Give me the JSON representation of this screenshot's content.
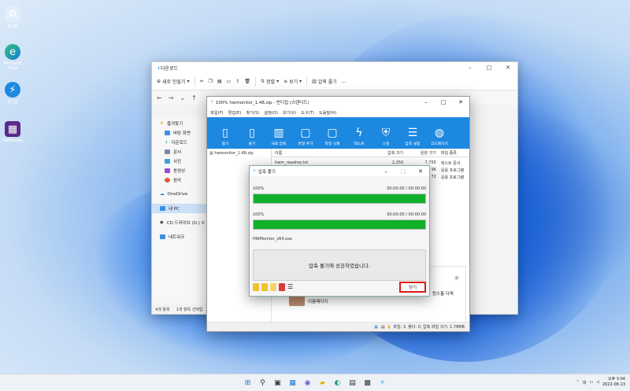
{
  "desktop": {
    "icons": [
      {
        "label": "휴지통",
        "icon": "recycle-bin-icon"
      },
      {
        "label": "Microsoft Edge",
        "icon": "edge-icon"
      },
      {
        "label": "반디집",
        "icon": "bandizip-icon"
      },
      {
        "label": "HWMonitor",
        "icon": "hwmonitor-icon"
      }
    ]
  },
  "explorer": {
    "title": "다운로드",
    "new_label": "새로 만들기",
    "sort_label": "정렬",
    "view_label": "보기",
    "extract_label": "압축 풀기",
    "more_label": "...",
    "sidebar": [
      "즐겨찾기",
      "바탕 화면",
      "다운로드",
      "문서",
      "사진",
      "동영상",
      "음악",
      "OneDrive",
      "내 PC",
      "CD 드라이브 (D:) V",
      "네트워크"
    ],
    "status_count": "4개 항목",
    "status_selected": "1개 항목 선택함"
  },
  "bandizip": {
    "title": "100% hwmonitor_1.48.zip - 반디집 (스탠더드)",
    "menu": [
      "파일(F)",
      "편집(E)",
      "찾기(S)",
      "설정(O)",
      "보기(V)",
      "도구(T)",
      "도움말(H)"
    ],
    "tools": [
      "열기",
      "풀기",
      "새로 압축",
      "파일 추가",
      "파일 삭제",
      "테스트",
      "스캔",
      "암호 설정",
      "코드페이지"
    ],
    "archive_name": "hwmonitor_1.48.zip",
    "columns": {
      "name": "이름",
      "size": "압축 크기",
      "orig": "원본 크기",
      "type": "파일 종류"
    },
    "rows": [
      {
        "name": "hwm_readme.txt",
        "size": "2,250",
        "orig": "7,755",
        "type": "텍스트 문서"
      },
      {
        "name": "",
        "size": "",
        "orig": "96",
        "type": "응용 프로그램"
      },
      {
        "name": "",
        "size": "",
        "orig": "72",
        "type": "응용 프로그램"
      }
    ],
    "info_text": "윈스톱 다욱",
    "info_sub": "이름페이지",
    "status": "파일: 3, 폴더: 0, 압축 파일 크기: 1.78MB"
  },
  "dialog": {
    "title": "압축 풀기",
    "p1_percent": "100%",
    "p1_time": "00:00:00 / 00:00:00",
    "p1_value": 100,
    "p2_percent": "100%",
    "p2_time": "00:00:00 / 00:00:00",
    "p2_value": 100,
    "current_file": "HWMonitor_x64.exe",
    "message": "압축 풀기에 성공하였습니다.",
    "close_label": "닫기"
  },
  "taskbar": {
    "lang": "대",
    "time": "오후 3:04",
    "date": "2022-08-13"
  },
  "colors": {
    "accent": "#1d88e0",
    "progress": "#12b02a",
    "close_border": "#e01818"
  }
}
